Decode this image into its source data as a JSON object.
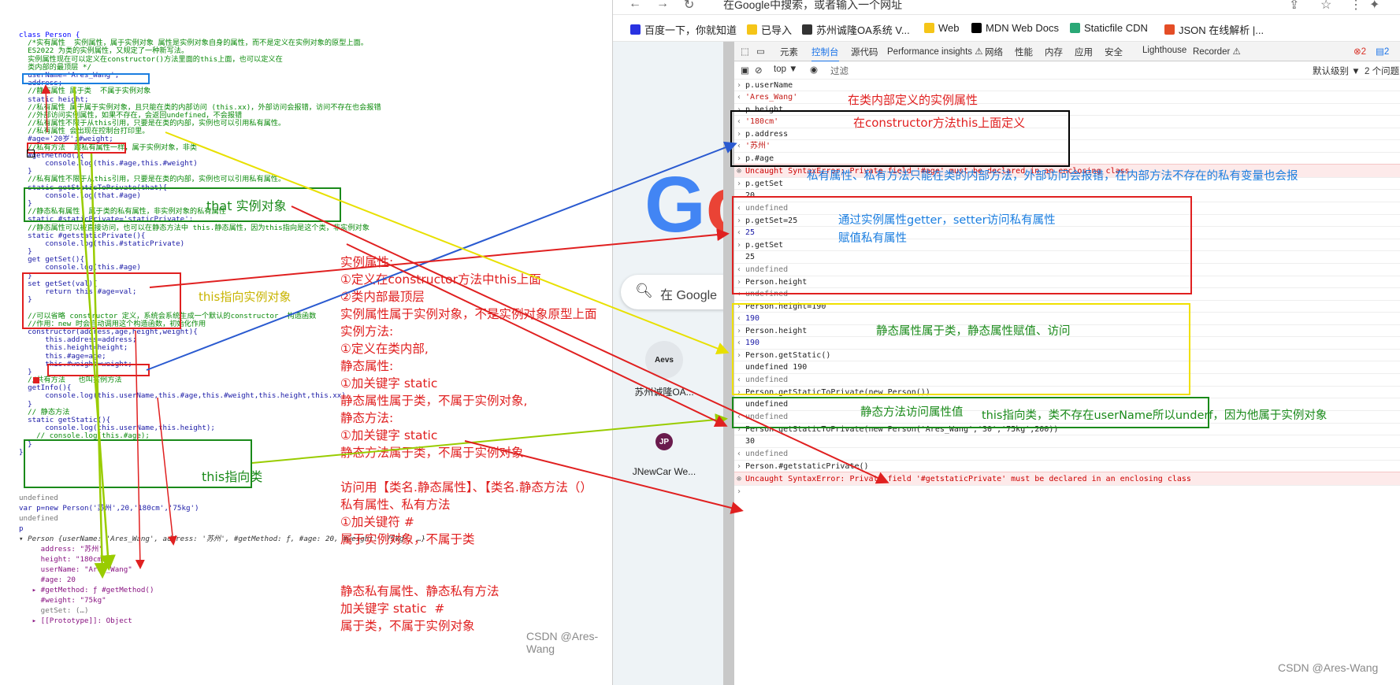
{
  "code_lines": [
    {
      "t": "class Person {",
      "cls": "k"
    },
    {
      "t": "  /*实有属性  实例属性，属于实例对象 属性是实例对象自身的属性，而不是定义在实例对象的原型上面。",
      "cls": "c"
    },
    {
      "t": "  ES2022 为类的实例属性，又规定了一种新写法。",
      "cls": "c"
    },
    {
      "t": "  实例属性现在可以定义在constructor()方法里面的this上面，也可以定义在",
      "cls": "c"
    },
    {
      "t": "  类内部的最顶层 */",
      "cls": "c"
    },
    {
      "t": "  userName='Ares_Wang';",
      "cls": "b"
    },
    {
      "t": "  address;",
      "cls": "b"
    },
    {
      "t": "  //静态属性 属于类  不属于实例对象",
      "cls": "c"
    },
    {
      "t": "  static height;",
      "cls": "b"
    },
    {
      "t": "  //私有属性 属于属于实例对象，且只能在类的内部访问 (this.xx)，外部访问会报错，访问不存在也会报错",
      "cls": "c"
    },
    {
      "t": "  //外部访问实例属性，如果不存在，会返回undefined，不会报错",
      "cls": "c"
    },
    {
      "t": "  //私有属性不限于从this引用，只要是在类的内部，实例也可以引用私有属性。",
      "cls": "c"
    },
    {
      "t": "  //私有属性 会出现在控制台打印里。",
      "cls": "c"
    },
    {
      "t": "  #age='20岁';#weight;",
      "cls": "b"
    },
    {
      "t": "  //私有方法  跟私有属性一样，属于实例对象，非类",
      "cls": "c"
    },
    {
      "t": "  #getMethod(){",
      "cls": "b"
    },
    {
      "t": "      console.log(this.#age,this.#weight)",
      "cls": "b"
    },
    {
      "t": "  }",
      "cls": "b"
    },
    {
      "t": "  //私有属性不限于从this引用，只要是在类的内部，实例也可以引用私有属性。",
      "cls": "c"
    },
    {
      "t": "  static getStaticToPrivate(that){",
      "cls": "b"
    },
    {
      "t": "      console.log(that.#age)",
      "cls": "b"
    },
    {
      "t": "  }",
      "cls": "b"
    },
    {
      "t": "  //静态私有属性  属于类的私有属性，非实例对象的私有属性",
      "cls": "c"
    },
    {
      "t": "  static #staticPrivate='staticPrivate';",
      "cls": "b"
    },
    {
      "t": "  //静态属性可以被直接访问，也可以在静态方法中 this.静态属性，因为this指向是这个类，非实例对象",
      "cls": "c"
    },
    {
      "t": "  static #getstaticPrivate(){",
      "cls": "b"
    },
    {
      "t": "      console.log(this.#staticPrivate)",
      "cls": "b"
    },
    {
      "t": "  }",
      "cls": "b"
    },
    {
      "t": "  get getSet(){",
      "cls": "b"
    },
    {
      "t": "      console.log(this.#age)",
      "cls": "b"
    },
    {
      "t": "  }",
      "cls": "b"
    },
    {
      "t": "  set getSet(val){",
      "cls": "b"
    },
    {
      "t": "      return this.#age=val;",
      "cls": "b"
    },
    {
      "t": "  }",
      "cls": "b"
    },
    {
      "t": "",
      "cls": "b"
    },
    {
      "t": "  //可以省略 constructor 定义，系统会系统生成一个默认的constructor  构造函数",
      "cls": "c"
    },
    {
      "t": "  //作用：new 时会自动调用这个构造函数，初始化作用",
      "cls": "c"
    },
    {
      "t": "  constructor(address,age,height,weight){",
      "cls": "b"
    },
    {
      "t": "      this.address=address;",
      "cls": "b"
    },
    {
      "t": "      this.height=height;",
      "cls": "b"
    },
    {
      "t": "      this.#age=age;",
      "cls": "b"
    },
    {
      "t": "      this.#weight=weight;",
      "cls": "b"
    },
    {
      "t": "  }",
      "cls": "b"
    },
    {
      "t": "  //共有方法   也叫实例方法",
      "cls": "c"
    },
    {
      "t": "  getInfo(){",
      "cls": "b"
    },
    {
      "t": "      console.log(this.userName,this.#age,this.#weight,this.height,this.xx)",
      "cls": "b"
    },
    {
      "t": "  }",
      "cls": "b"
    },
    {
      "t": "  // 静态方法",
      "cls": "c"
    },
    {
      "t": "  static getStatic(){",
      "cls": "b"
    },
    {
      "t": "      console.log(this.userName,this.height);",
      "cls": "b"
    },
    {
      "t": "    // console.log(this.#age);",
      "cls": "c"
    },
    {
      "t": "  }",
      "cls": "b"
    },
    {
      "t": "}",
      "cls": "b"
    }
  ],
  "left_console": [
    {
      "t": "undefined",
      "cls": "g"
    },
    {
      "t": "var p=new Person('苏州',20,'180cm','75kg')",
      "cls": "b"
    },
    {
      "t": "undefined",
      "cls": "g"
    },
    {
      "t": "p",
      "cls": "b"
    },
    {
      "t": "▾ Person {userName: 'Ares_Wang', address: '苏州', #getMethod: ƒ, #age: 20, #weight: '75kg', …}",
      "cls": "it"
    },
    {
      "t": "     address: \"苏州\"",
      "cls": "p"
    },
    {
      "t": "     height: \"180cm\"",
      "cls": "p"
    },
    {
      "t": "     userName: \"Ares_Wang\"",
      "cls": "p"
    },
    {
      "t": "     #age: 20",
      "cls": "p"
    },
    {
      "t": "   ▸ #getMethod: ƒ #getMethod()",
      "cls": "p"
    },
    {
      "t": "     #weight: \"75kg\"",
      "cls": "p"
    },
    {
      "t": "     getSet: (…)",
      "cls": "g"
    },
    {
      "t": "   ▸ [[Prototype]]: Object",
      "cls": "p"
    }
  ],
  "annotations": {
    "that_instance": "that 实例对象",
    "this_instance": "this指向实例对象",
    "this_class": "this指向类",
    "notes": "实例属性:\n①定义在constructor方法中this上面\n②类内部最顶层\n实例属性属于实例对象，不是实例对象原型上面\n实例方法:\n①定义在类内部,\n静态属性:\n①加关键字 static\n静态属性属于类，不属于实例对象,\n静态方法:\n①加关键字 static\n静态方法属于类，不属于实例对象\n\n访问用【类名.静态属性】、【类名.静态方法（）\n私有属性、私有方法\n①加关键符 #\n属于实例对象，不属于类\n\n\n静态私有属性、静态私有方法\n加关键字 static  #\n属于类，不属于实例对象",
    "r_instance_in_class": "在类内部定义的实例属性",
    "r_constructor_this": "在constructor方法this上面定义",
    "r_private": "私有属性、私有方法只能在类的内部方法，外部访问会报错，在内部方法不存在的私有变量也会报",
    "r_getter_setter_1": "通过实例属性getter，setter访问私有属性",
    "r_getter_setter_2": "赋值私有属性",
    "r_static": "静态属性属于类，静态属性赋值、访问",
    "r_static_method": "静态方法访问属性值",
    "r_this_class": "this指向类，类不存在userName所以underf，因为他属于实例对象"
  },
  "watermark_left": "CSDN @Ares-Wang",
  "watermark_right": "CSDN @Ares-Wang",
  "browser": {
    "address_text": "在Google中搜索，或者输入一个网址",
    "bookmarks": [
      {
        "label": "百度一下，你就知道",
        "color": "#2932e1"
      },
      {
        "label": "已导入",
        "color": "#f5c518"
      },
      {
        "label": "苏州诚隆OA系统 V...",
        "color": "#333"
      },
      {
        "label": "Web",
        "color": "#f5c518"
      },
      {
        "label": "MDN Web Docs",
        "color": "#000"
      },
      {
        "label": "Staticfile CDN",
        "color": "#2aa876"
      },
      {
        "label": "JSON 在线解析 |...",
        "color": "#e44d26"
      }
    ],
    "search_placeholder": "在 Google",
    "shortcuts": [
      {
        "label": "苏州诚隆OA...",
        "icon": "Aevs"
      },
      {
        "label": "JNewCar We...",
        "icon": "JP"
      }
    ]
  },
  "devtools": {
    "tabs": [
      "元素",
      "控制台",
      "源代码",
      "Performance insights ⚠",
      "网络",
      "性能",
      "内存",
      "应用",
      "安全",
      "Lighthouse",
      "Recorder ⚠"
    ],
    "active_tab": "控制台",
    "badges": [
      "2",
      "2"
    ],
    "filter_context": "top ▼",
    "filter_placeholder": "过滤",
    "level": "默认级别 ▼",
    "issues": "2 个问题"
  },
  "console_lines": [
    {
      "t": "p.userName",
      "kind": "in"
    },
    {
      "t": "'Ares_Wang'",
      "kind": "outs"
    },
    {
      "t": "p.height",
      "kind": "in"
    },
    {
      "t": "'180cm'",
      "kind": "outs"
    },
    {
      "t": "p.address",
      "kind": "in"
    },
    {
      "t": "'苏州'",
      "kind": "outs"
    },
    {
      "t": "p.#age",
      "kind": "in"
    },
    {
      "t": "Uncaught SyntaxError: Private field '#age' must be declared in an enclosing class",
      "kind": "err"
    },
    {
      "t": "p.getSet",
      "kind": "in"
    },
    {
      "t": "20",
      "kind": "log"
    },
    {
      "t": "undefined",
      "kind": "outu"
    },
    {
      "t": "p.getSet=25",
      "kind": "in"
    },
    {
      "t": "25",
      "kind": "outn"
    },
    {
      "t": "p.getSet",
      "kind": "in"
    },
    {
      "t": "25",
      "kind": "log"
    },
    {
      "t": "undefined",
      "kind": "outu"
    },
    {
      "t": "Person.height",
      "kind": "in"
    },
    {
      "t": "undefined",
      "kind": "outu"
    },
    {
      "t": "Person.height=190",
      "kind": "in"
    },
    {
      "t": "190",
      "kind": "outn"
    },
    {
      "t": "Person.height",
      "kind": "in"
    },
    {
      "t": "190",
      "kind": "outn"
    },
    {
      "t": "Person.getStatic()",
      "kind": "in"
    },
    {
      "t": "undefined 190",
      "kind": "log"
    },
    {
      "t": "undefined",
      "kind": "outu"
    },
    {
      "t": "Person.getStaticToPrivate(new Person())",
      "kind": "in"
    },
    {
      "t": "undefined",
      "kind": "log"
    },
    {
      "t": "undefined",
      "kind": "outu"
    },
    {
      "t": "Person.getStaticToPrivate(new Person('Ares_Wang','30','75kg',200))",
      "kind": "in"
    },
    {
      "t": "30",
      "kind": "log"
    },
    {
      "t": "undefined",
      "kind": "outu"
    },
    {
      "t": "Person.#getstaticPrivate()",
      "kind": "in"
    },
    {
      "t": "Uncaught SyntaxError: Private field '#getstaticPrivate' must be declared in an enclosing class",
      "kind": "err"
    },
    {
      "t": "",
      "kind": "prompt"
    }
  ]
}
